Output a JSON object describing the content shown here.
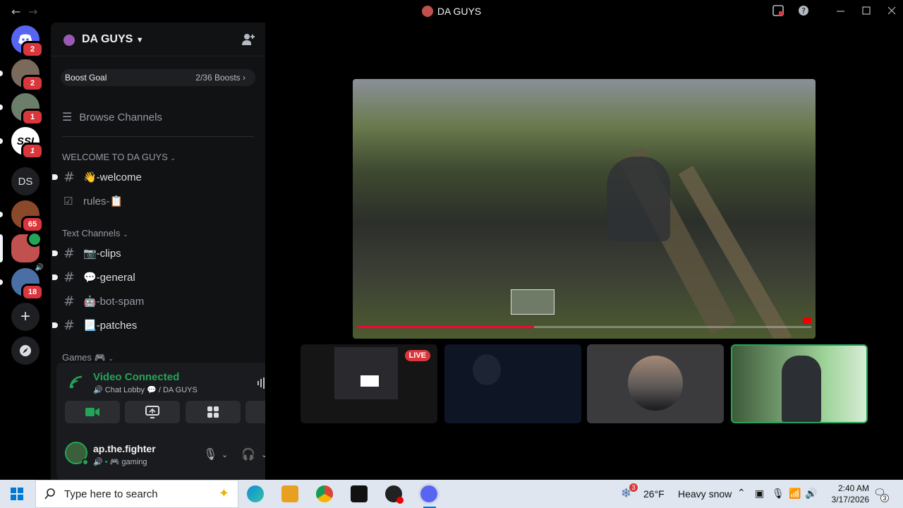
{
  "window": {
    "title": "DA GUYS",
    "nav_back": "←",
    "nav_forward": "→"
  },
  "rail": {
    "home_badge": "2",
    "servers": [
      {
        "badge": "2"
      },
      {
        "badge": "1"
      },
      {
        "badge": "1"
      },
      {
        "label": "DS"
      },
      {
        "badge": "65"
      },
      {
        "badge": ""
      },
      {
        "badge": "18"
      }
    ]
  },
  "guild": {
    "name": "DA GUYS",
    "boost_label": "Boost Goal",
    "boost_count": "2/36 Boosts"
  },
  "browse_label": "Browse Channels",
  "categories": {
    "welcome": "WELCOME TO DA GUYS",
    "text": "Text Channels",
    "games": "Games 🎮"
  },
  "channels": {
    "welcome": "👋-welcome",
    "rules": "rules-📋",
    "clips": "📷-clips",
    "general": "💬-general",
    "botspam": "🤖-bot-spam",
    "patches": "📃-patches"
  },
  "voice": {
    "status": "Video Connected",
    "location": "Chat Lobby 💬 / DA GUYS"
  },
  "user": {
    "name": "ap.the.fighter",
    "status": "🎮 gaming"
  },
  "stream": {
    "live_label": "LIVE",
    "progress": 0.39
  },
  "taskbar": {
    "search_placeholder": "Type here to search",
    "weather_temp": "26°F",
    "weather_desc": "Heavy snow",
    "weather_badge": "3",
    "time": "2:40 AM",
    "date": "3/17/2026",
    "notif_count": "3"
  },
  "colors": {
    "accent_green": "#23a559",
    "badge_red": "#da373c",
    "blurple": "#5865f2"
  }
}
